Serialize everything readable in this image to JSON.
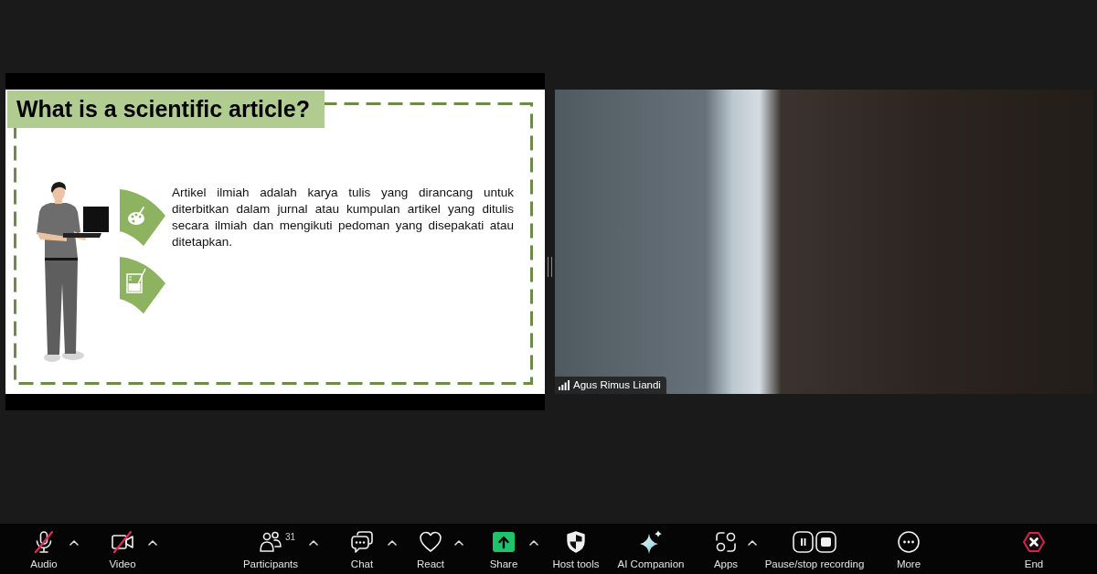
{
  "shared_screen": {
    "slide": {
      "title": "What is a scientific article?",
      "paragraph": "Artikel ilmiah adalah karya tulis yang dirancang untuk diterbitkan dalam jurnal atau kumpulan artikel yang ditulis secara ilmiah dan mengikuti pedoman yang disepakati atau ditetapkan."
    }
  },
  "video": {
    "participant_name": "Agus Rimus Liandi"
  },
  "toolbar": {
    "items": [
      {
        "kind": "audio",
        "label": "Audio",
        "off": true,
        "has_menu": true
      },
      {
        "kind": "video",
        "label": "Video",
        "off": true,
        "has_menu": true
      },
      {
        "kind": "participants",
        "label": "Participants",
        "count": "31",
        "off": false,
        "has_menu": true
      },
      {
        "kind": "chat",
        "label": "Chat",
        "off": false,
        "has_menu": true
      },
      {
        "kind": "react",
        "label": "React",
        "off": false,
        "has_menu": true
      },
      {
        "kind": "share",
        "label": "Share",
        "off": false,
        "has_menu": true
      },
      {
        "kind": "host_tools",
        "label": "Host tools",
        "off": false,
        "has_menu": false
      },
      {
        "kind": "ai_companion",
        "label": "AI Companion",
        "off": false,
        "has_menu": false
      },
      {
        "kind": "apps",
        "label": "Apps",
        "off": false,
        "has_menu": true
      },
      {
        "kind": "recording",
        "label": "Pause/stop recording",
        "off": false,
        "has_menu": false
      },
      {
        "kind": "more",
        "label": "More",
        "off": false,
        "has_menu": false
      },
      {
        "kind": "end",
        "label": "End",
        "off": false,
        "has_menu": false
      }
    ]
  }
}
